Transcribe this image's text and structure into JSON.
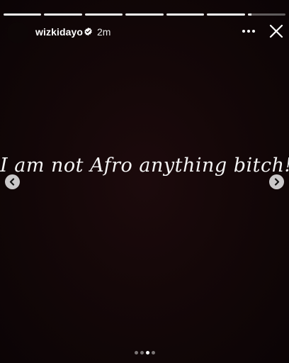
{
  "story": {
    "progress": [
      1,
      1,
      1,
      1,
      1,
      1,
      0.1
    ],
    "username": "wizkidayo",
    "verified": true,
    "timestamp": "2m",
    "caption": "I am not Afro anything bitch!",
    "carousel": {
      "count": 4,
      "active_index": 2
    }
  },
  "icons": {
    "verified": "verified-badge-icon",
    "more": "more-options-icon",
    "close": "close-icon",
    "prev": "chevron-left-icon",
    "next": "chevron-right-icon"
  },
  "colors": {
    "background": "#140708",
    "text": "#ffffff"
  }
}
